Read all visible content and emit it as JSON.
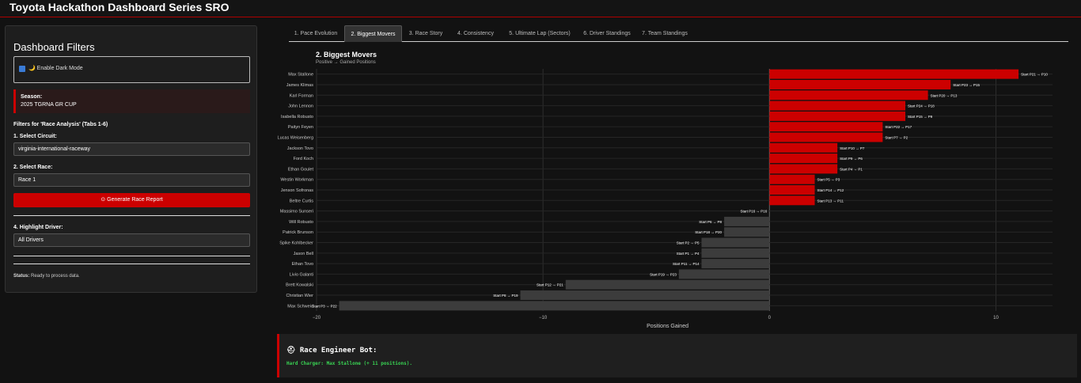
{
  "app": {
    "title": "Toyota Hackathon Dashboard Series SRO"
  },
  "sidebar": {
    "title": "Dashboard Filters",
    "dark_mode_label": "🌙 Enable Dark Mode",
    "season_label": "Season:",
    "season_value": "2025 TGRNA GR CUP",
    "filters_heading": "Filters for 'Race Analysis' (Tabs 1-6)",
    "circuit_label": "1. Select Circuit:",
    "circuit_value": "virginia-international-raceway",
    "race_label": "2. Select Race:",
    "race_value": "Race 1",
    "generate_label": "⊙ Generate Race Report",
    "driver_label": "4. Highlight Driver:",
    "driver_value": "All Drivers",
    "status_key": "Status:",
    "status_value": "Ready to process data."
  },
  "tabs": [
    {
      "label": "1. Pace Evolution"
    },
    {
      "label": "2. Biggest Movers"
    },
    {
      "label": "3. Race Story"
    },
    {
      "label": "4. Consistency"
    },
    {
      "label": "5. Ultimate Lap (Sectors)"
    },
    {
      "label": "6. Driver Standings"
    },
    {
      "label": "7. Team Standings"
    }
  ],
  "colors": {
    "positive": "#cc0000",
    "negative": "#3c3c3c",
    "accent": "#cc0000"
  },
  "chart_data": {
    "type": "bar",
    "orientation": "horizontal",
    "title": "2. Biggest Movers",
    "subtitle": "Positive → Gained Positions",
    "xlabel": "Positions Gained",
    "xlim": [
      -20,
      12.5
    ],
    "xticks": [
      -20,
      -10,
      0,
      10
    ],
    "bars": [
      {
        "driver": "Max Stallone",
        "value": 11,
        "label": "Start P21 → P10"
      },
      {
        "driver": "James Klimas",
        "value": 8,
        "label": "Start P23 → P15"
      },
      {
        "driver": "Karl Forman",
        "value": 7,
        "label": "Start P20 → P13"
      },
      {
        "driver": "John Lennon",
        "value": 6,
        "label": "Start P24 → P18"
      },
      {
        "driver": "Isabella Robusto",
        "value": 6,
        "label": "Start P15 → P9"
      },
      {
        "driver": "Paityn Feyen",
        "value": 5,
        "label": "Start P22 → P17"
      },
      {
        "driver": "Lucas Weisenberg",
        "value": 5,
        "label": "Start P7 → P2"
      },
      {
        "driver": "Jackson Tovo",
        "value": 3,
        "label": "Start P10 → P7"
      },
      {
        "driver": "Ford Koch",
        "value": 3,
        "label": "Start P9 → P6"
      },
      {
        "driver": "Ethan Goulet",
        "value": 3,
        "label": "Start P4 → P1"
      },
      {
        "driver": "Westin Workman",
        "value": 2,
        "label": "Start P5 → P3"
      },
      {
        "driver": "Jenson Sofronas",
        "value": 2,
        "label": "Start P14 → P12"
      },
      {
        "driver": "Beltre Curtis",
        "value": 2,
        "label": "Start P13 → P11"
      },
      {
        "driver": "Massimo Sunseri",
        "value": 0,
        "label": "Start P16 → P16"
      },
      {
        "driver": "Will Robusto",
        "value": -2,
        "label": "Start P6 → P8"
      },
      {
        "driver": "Patrick Brunson",
        "value": -2,
        "label": "Start P18 → P20"
      },
      {
        "driver": "Spike Kohlbecker",
        "value": -3,
        "label": "Start P2 → P5"
      },
      {
        "driver": "Jason Bell",
        "value": -3,
        "label": "Start P1 → P4"
      },
      {
        "driver": "Ethan Tovo",
        "value": -3,
        "label": "Start P11 → P14"
      },
      {
        "driver": "Livio Galanti",
        "value": -4,
        "label": "Start P19 → P23"
      },
      {
        "driver": "Brett Kowalski",
        "value": -9,
        "label": "Start P12 → P21"
      },
      {
        "driver": "Christian Wier",
        "value": -11,
        "label": "Start P8 → P19"
      },
      {
        "driver": "Max Schweid",
        "value": -19,
        "label": "Start P3 → P22"
      }
    ]
  },
  "bot": {
    "title": "⛑ Race Engineer Bot:",
    "message": "Hard Charger: Max Stallone (+ 11 positions)."
  }
}
